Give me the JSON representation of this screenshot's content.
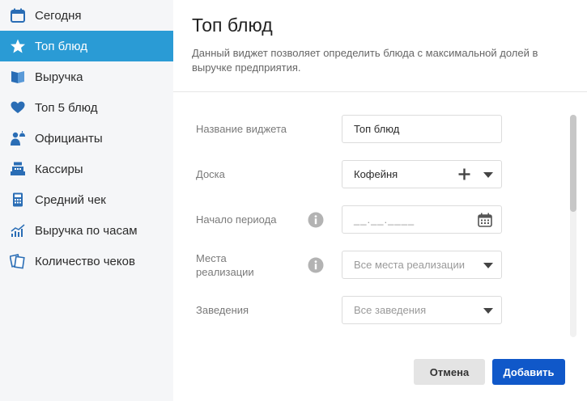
{
  "sidebar": {
    "items": [
      {
        "label": "Сегодня",
        "icon": "calendar-icon",
        "active": false
      },
      {
        "label": "Топ блюд",
        "icon": "star-icon",
        "active": true
      },
      {
        "label": "Выручка",
        "icon": "book-icon",
        "active": false
      },
      {
        "label": "Топ 5 блюд",
        "icon": "heart-icon",
        "active": false
      },
      {
        "label": "Официанты",
        "icon": "waiter-icon",
        "active": false
      },
      {
        "label": "Кассиры",
        "icon": "cash-register-icon",
        "active": false
      },
      {
        "label": "Средний чек",
        "icon": "calculator-icon",
        "active": false
      },
      {
        "label": "Выручка по часам",
        "icon": "chart-icon",
        "active": false
      },
      {
        "label": "Количество чеков",
        "icon": "receipts-icon",
        "active": false
      }
    ]
  },
  "main": {
    "title": "Топ блюд",
    "description": "Данный виджет позволяет определить блюда с максимальной долей в выручке предприятия."
  },
  "form": {
    "widget_name": {
      "label": "Название виджета",
      "value": "Топ блюд"
    },
    "board": {
      "label": "Доска",
      "value": "Кофейня"
    },
    "period_start": {
      "label": "Начало периода",
      "placeholder": "__.__.____"
    },
    "sale_places": {
      "label_line1": "Места",
      "label_line2": "реализации",
      "placeholder": "Все места реализации"
    },
    "establishments": {
      "label": "Заведения",
      "placeholder": "Все заведения"
    }
  },
  "buttons": {
    "cancel": "Отмена",
    "add": "Добавить"
  },
  "colors": {
    "accent": "#2a9bd5",
    "primary_button": "#1058c9",
    "icon": "#2a6db5"
  }
}
